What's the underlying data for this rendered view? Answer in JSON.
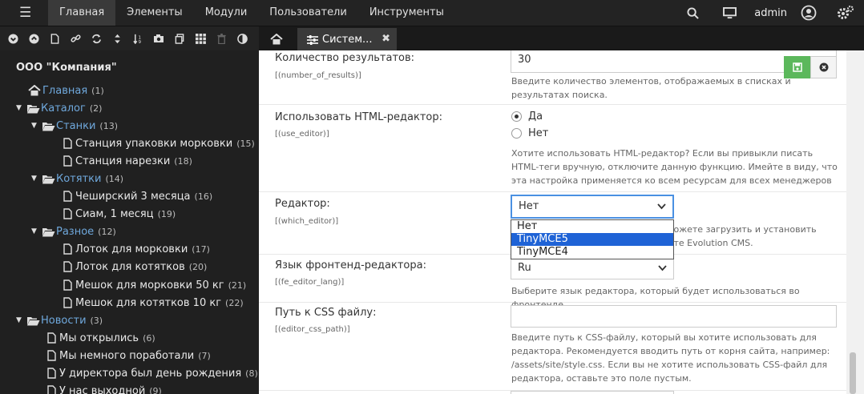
{
  "topbar": {
    "nav": [
      "Главная",
      "Элементы",
      "Модули",
      "Пользователи",
      "Инструменты"
    ],
    "user": "admin"
  },
  "tree": {
    "site_name": "ООО \"Компания\"",
    "nodes": [
      {
        "label": "Главная",
        "count": "(1)"
      },
      {
        "label": "Каталог",
        "count": "(2)"
      },
      {
        "label": "Станки",
        "count": "(13)"
      },
      {
        "label": "Станция упаковки морковки",
        "count": "(15)"
      },
      {
        "label": "Станция нарезки",
        "count": "(18)"
      },
      {
        "label": "Котятки",
        "count": "(14)"
      },
      {
        "label": "Чеширский 3 месяца",
        "count": "(16)"
      },
      {
        "label": "Сиам, 1 месяц",
        "count": "(19)"
      },
      {
        "label": "Разное",
        "count": "(12)"
      },
      {
        "label": "Лоток для морковки",
        "count": "(17)"
      },
      {
        "label": "Лоток для котятков",
        "count": "(20)"
      },
      {
        "label": "Мешок для морковки 50 кг",
        "count": "(21)"
      },
      {
        "label": "Мешок для котятков 10 кг",
        "count": "(22)"
      },
      {
        "label": "Новости",
        "count": "(3)"
      },
      {
        "label": "Мы открылись",
        "count": "(6)"
      },
      {
        "label": "Мы немного поработали",
        "count": "(7)"
      },
      {
        "label": "У директора был день рождения",
        "count": "(8)"
      },
      {
        "label": "У нас выходной",
        "count": "(9)"
      }
    ]
  },
  "tabs": {
    "doc_tab_label": "Систем..."
  },
  "settings": {
    "results": {
      "title": "Количество результатов:",
      "key": "[(number_of_results)]",
      "value": "30",
      "help": "Введите количество элементов, отображаемых в списках и результатах поиска."
    },
    "use_editor": {
      "title": "Использовать HTML-редактор:",
      "key": "[(use_editor)]",
      "opt_yes": "Да",
      "opt_no": "Нет",
      "help": "Хотите использовать HTML-редактор? Если вы привыкли писать HTML-теги вручную, отключите данную функцию. Имейте в виду, что эта настройка применяется ко всем ресурсам для всех менеджеров"
    },
    "which_editor": {
      "title": "Редактор:",
      "key": "[(which_editor)]",
      "value": "Нет",
      "help_line1": "...ожете загрузить и установить",
      "help_line2": "...те Evolution CMS.",
      "options": [
        "Нет",
        "TinyMCE5",
        "TinyMCE4"
      ],
      "highlighted": "TinyMCE5"
    },
    "fe_editor_lang": {
      "title": "Язык фронтенд-редактора:",
      "key": "[(fe_editor_lang)]",
      "value": "Ru",
      "help": "Выберите язык редактора, который будет использоваться во фронтенде."
    },
    "editor_css_path": {
      "title": "Путь к CSS файлу:",
      "key": "[(editor_css_path)]",
      "value": "",
      "help": "Введите путь к CSS-файлу, который вы хотите использовать для редактора. Рекомендуется вводить путь от корня сайта, например: /assets/site/style.css. Если вы не хотите использовать CSS-файл для редактора, оставьте это поле пустым."
    }
  },
  "colors": {
    "link": "#6fa8dc",
    "save": "#5cb85c",
    "highlight": "#1f63d6"
  }
}
